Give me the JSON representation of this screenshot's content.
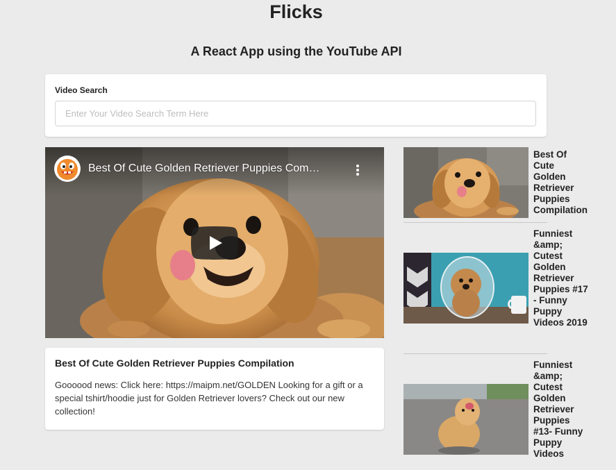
{
  "header": {
    "title": "Flicks",
    "subtitle": "A React App using the YouTube API"
  },
  "search": {
    "label": "Video Search",
    "placeholder": "Enter Your Video Search Term Here",
    "value": ""
  },
  "player": {
    "title": "Best Of Cute Golden Retriever Puppies Com…",
    "avatar_icon": "cartoon-face-avatar-icon",
    "menu_icon": "kebab-menu-icon",
    "play_icon": "youtube-play-icon"
  },
  "details": {
    "title": "Best Of Cute Golden Retriever Puppies Compilation",
    "description": "Goooood news: Click here: https://maipm.net/GOLDEN Looking for a gift or a special tshirt/hoodie just for Golden Retriever lovers? Check out our new collection!"
  },
  "video_list": [
    {
      "title": "Best Of Cute Golden Retriever Puppies Compilation"
    },
    {
      "title": "Funniest &amp; Cutest Golden Retriever Puppies #17 - Funny Puppy Videos 2019"
    },
    {
      "title": "Funniest &amp; Cutest Golden Retriever Puppies #13- Funny Puppy Videos"
    }
  ],
  "colors": {
    "background": "#ebebeb",
    "card": "#ffffff",
    "text": "#222222",
    "play_button": "#212121"
  }
}
